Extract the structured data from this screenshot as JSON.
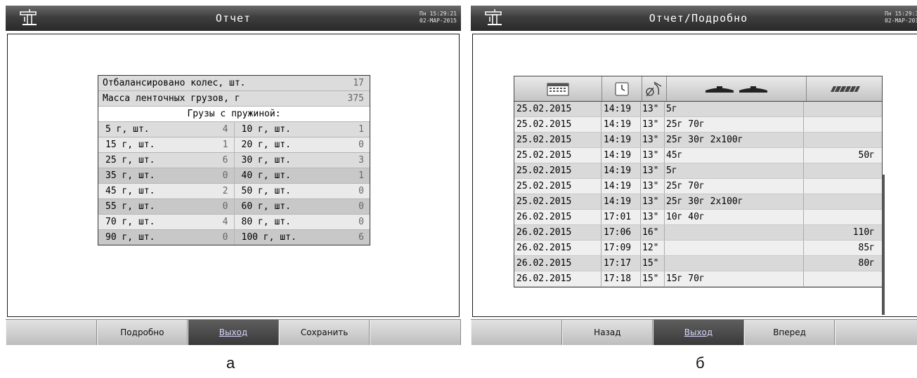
{
  "screen_a": {
    "title": "Отчет",
    "clock": {
      "line1": "Пн 15:29:21",
      "line2": "02-МАР-2015"
    },
    "summary": {
      "balanced_label": "Отбалансировано колес, шт.",
      "balanced_value": "17",
      "tape_mass_label": "Масса ленточных грузов, г",
      "tape_mass_value": "375",
      "spring_header": "Грузы с пружиной:",
      "rows": [
        {
          "l_label": "5 г, шт.",
          "l_val": "4",
          "r_label": "10 г, шт.",
          "r_val": "1"
        },
        {
          "l_label": "15 г, шт.",
          "l_val": "1",
          "r_label": "20 г, шт.",
          "r_val": "0"
        },
        {
          "l_label": "25 г, шт.",
          "l_val": "6",
          "r_label": "30 г, шт.",
          "r_val": "3"
        },
        {
          "l_label": "35 г, шт.",
          "l_val": "0",
          "r_label": "40 г, шт.",
          "r_val": "1"
        },
        {
          "l_label": "45 г, шт.",
          "l_val": "2",
          "r_label": "50 г, шт.",
          "r_val": "0"
        },
        {
          "l_label": "55 г, шт.",
          "l_val": "0",
          "r_label": "60 г, шт.",
          "r_val": "0"
        },
        {
          "l_label": "70 г, шт.",
          "l_val": "4",
          "r_label": "80 г, шт.",
          "r_val": "0"
        },
        {
          "l_label": "90 г, шт.",
          "l_val": "0",
          "r_label": "100 г, шт.",
          "r_val": "6"
        }
      ]
    },
    "buttons": [
      "",
      "Подробно",
      "Выход",
      "Сохранить",
      ""
    ],
    "caption": "а"
  },
  "screen_b": {
    "title": "Отчет/Подробно",
    "clock": {
      "line1": "Пн 15:29:30",
      "line2": "02-МАР-2015"
    },
    "rows": [
      {
        "date": "25.02.2015",
        "time": "14:19",
        "dia": "13\"",
        "spring": "5г",
        "tape": ""
      },
      {
        "date": "25.02.2015",
        "time": "14:19",
        "dia": "13\"",
        "spring": "25г 70г",
        "tape": ""
      },
      {
        "date": "25.02.2015",
        "time": "14:19",
        "dia": "13\"",
        "spring": "25г 30г 2x100г",
        "tape": ""
      },
      {
        "date": "25.02.2015",
        "time": "14:19",
        "dia": "13\"",
        "spring": "45г",
        "tape": "50г"
      },
      {
        "date": "25.02.2015",
        "time": "14:19",
        "dia": "13\"",
        "spring": "5г",
        "tape": ""
      },
      {
        "date": "25.02.2015",
        "time": "14:19",
        "dia": "13\"",
        "spring": "25г 70г",
        "tape": ""
      },
      {
        "date": "25.02.2015",
        "time": "14:19",
        "dia": "13\"",
        "spring": "25г 30г 2x100г",
        "tape": ""
      },
      {
        "date": "26.02.2015",
        "time": "17:01",
        "dia": "13\"",
        "spring": "10г 40г",
        "tape": ""
      },
      {
        "date": "26.02.2015",
        "time": "17:06",
        "dia": "16\"",
        "spring": "",
        "tape": "110г"
      },
      {
        "date": "26.02.2015",
        "time": "17:09",
        "dia": "12\"",
        "spring": "",
        "tape": "85г"
      },
      {
        "date": "26.02.2015",
        "time": "17:17",
        "dia": "15\"",
        "spring": "",
        "tape": "80г"
      },
      {
        "date": "26.02.2015",
        "time": "17:18",
        "dia": "15\"",
        "spring": "15г 70г",
        "tape": ""
      }
    ],
    "buttons": [
      "",
      "Назад",
      "Выход",
      "Вперед",
      ""
    ],
    "caption": "б"
  }
}
